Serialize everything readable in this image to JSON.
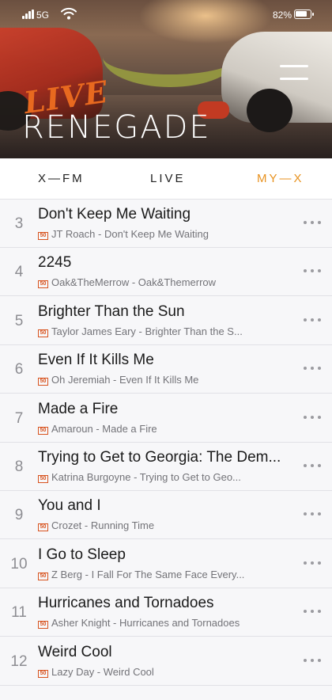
{
  "status_bar": {
    "network": "5G",
    "battery_percent": "82%",
    "battery_level": 0.82
  },
  "header": {
    "logo_script": "LIVE",
    "logo_main": "RENEGADE",
    "menu_icon": "hamburger-menu-icon"
  },
  "tabs": [
    {
      "label": "X—FM",
      "active": false
    },
    {
      "label": "LIVE",
      "active": false
    },
    {
      "label": "MY—X",
      "active": true
    }
  ],
  "colors": {
    "accent": "#e8921f",
    "logo_orange": "#e8691f",
    "badge": "#d8531f"
  },
  "tracks": [
    {
      "num": "3",
      "title": "Don't Keep Me Waiting",
      "source_badge": "50",
      "subtitle": "JT Roach - Don't Keep Me Waiting"
    },
    {
      "num": "4",
      "title": "2245",
      "source_badge": "50",
      "subtitle": "Oak&TheMerrow - Oak&Themerrow"
    },
    {
      "num": "5",
      "title": "Brighter Than the Sun",
      "source_badge": "50",
      "subtitle": "Taylor James Eary - Brighter Than the S..."
    },
    {
      "num": "6",
      "title": "Even If It Kills Me",
      "source_badge": "50",
      "subtitle": "Oh Jeremiah - Even If It Kills Me"
    },
    {
      "num": "7",
      "title": "Made a Fire",
      "source_badge": "50",
      "subtitle": "Amaroun - Made a Fire"
    },
    {
      "num": "8",
      "title": "Trying to Get to Georgia: The Dem...",
      "source_badge": "50",
      "subtitle": "Katrina Burgoyne - Trying to Get to Geo..."
    },
    {
      "num": "9",
      "title": "You and I",
      "source_badge": "50",
      "subtitle": "Crozet - Running Time"
    },
    {
      "num": "10",
      "title": "I Go to Sleep",
      "source_badge": "50",
      "subtitle": "Z Berg - I Fall For The Same Face Every..."
    },
    {
      "num": "11",
      "title": "Hurricanes and Tornadoes",
      "source_badge": "50",
      "subtitle": "Asher Knight - Hurricanes and Tornadoes"
    },
    {
      "num": "12",
      "title": "Weird Cool",
      "source_badge": "50",
      "subtitle": "Lazy Day - Weird Cool"
    }
  ]
}
